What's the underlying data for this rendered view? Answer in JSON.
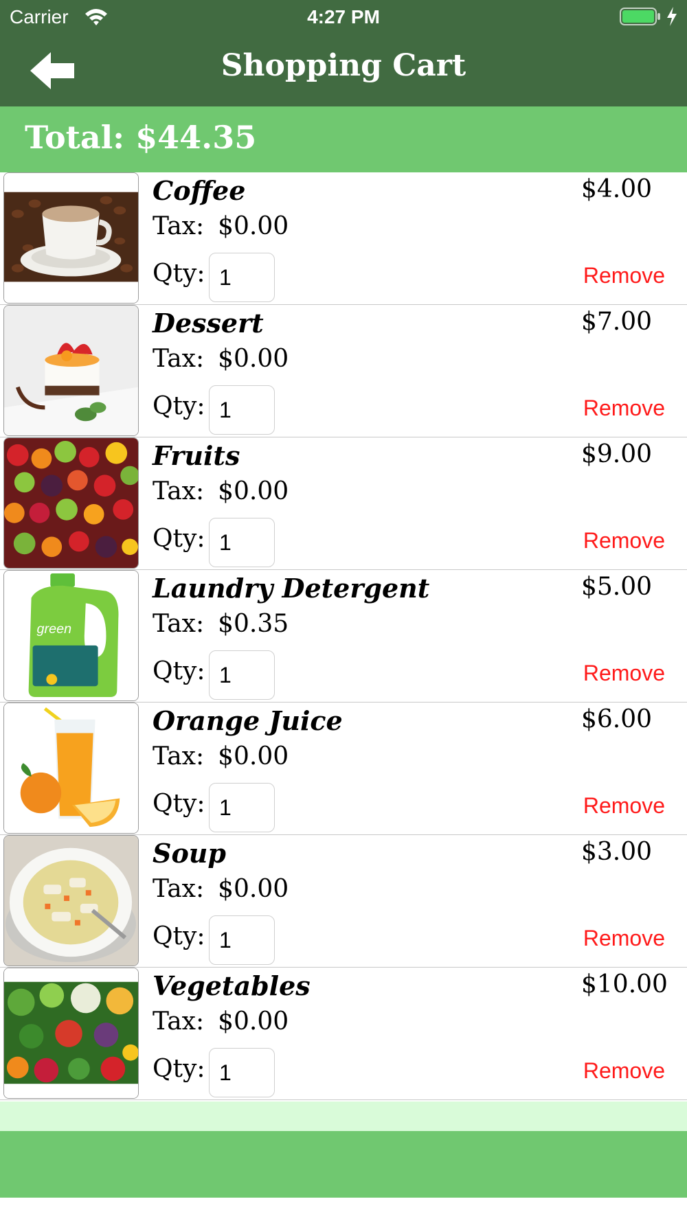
{
  "status_bar": {
    "carrier": "Carrier",
    "time": "4:27 PM",
    "battery_color": "#4cd964"
  },
  "nav": {
    "title": "Shopping Cart",
    "back_icon": "back-arrow-icon"
  },
  "total": {
    "text": "Total: $44.35"
  },
  "labels": {
    "tax": "Tax:",
    "qty": "Qty:",
    "remove": "Remove"
  },
  "items": [
    {
      "name": "Coffee",
      "price": "$4.00",
      "tax": "$0.00",
      "qty": "1",
      "image": "coffee-image"
    },
    {
      "name": "Dessert",
      "price": "$7.00",
      "tax": "$0.00",
      "qty": "1",
      "image": "dessert-image"
    },
    {
      "name": "Fruits",
      "price": "$9.00",
      "tax": "$0.00",
      "qty": "1",
      "image": "fruits-image"
    },
    {
      "name": "Laundry Detergent",
      "price": "$5.00",
      "tax": "$0.35",
      "qty": "1",
      "image": "laundry-detergent-image"
    },
    {
      "name": "Orange Juice",
      "price": "$6.00",
      "tax": "$0.00",
      "qty": "1",
      "image": "orange-juice-image"
    },
    {
      "name": "Soup",
      "price": "$3.00",
      "tax": "$0.00",
      "qty": "1",
      "image": "soup-image"
    },
    {
      "name": "Vegetables",
      "price": "$10.00",
      "tax": "$0.00",
      "qty": "1",
      "image": "vegetables-image"
    }
  ],
  "colors": {
    "nav_bg": "#416b41",
    "total_bg": "#70c870",
    "footer_bg": "#70c870",
    "spacer_bg": "#d9fbd9",
    "remove": "#ff1a1a"
  }
}
